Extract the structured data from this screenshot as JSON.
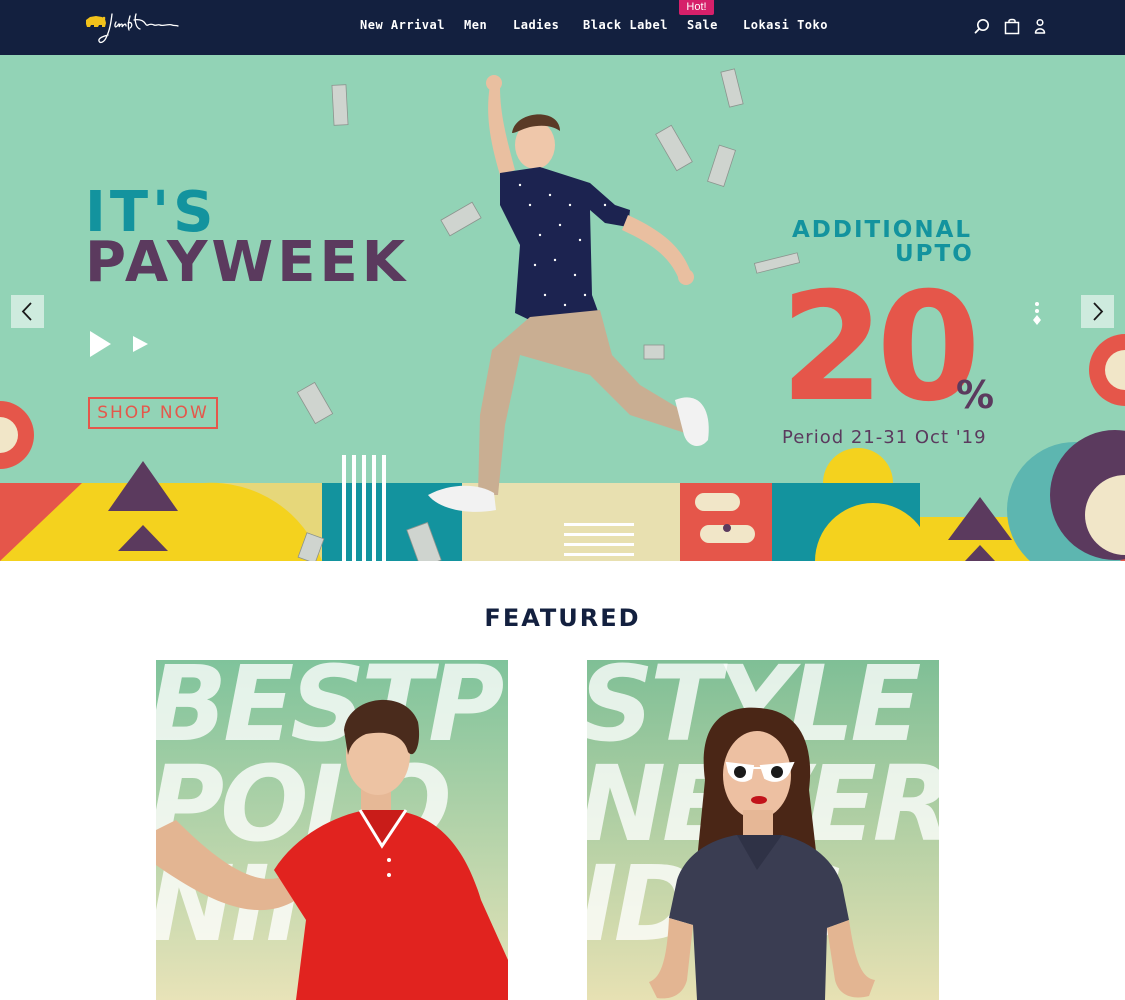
{
  "header": {
    "logo": {
      "icon": "bear-logo-icon",
      "alt": "Jack Nicklaus"
    },
    "nav": [
      {
        "label": "New Arrival"
      },
      {
        "label": "Men"
      },
      {
        "label": "Ladies"
      },
      {
        "label": "Black Label"
      },
      {
        "label": "Sale",
        "badge": "Hot!"
      },
      {
        "label": "Lokasi Toko"
      }
    ],
    "icons": [
      "search-icon",
      "shopping-bag-icon",
      "user-icon"
    ]
  },
  "hero": {
    "headline_line1": "IT'S",
    "headline_line2": "PAYWEEK",
    "cta": "SHOP NOW",
    "promo_line1": "ADDITIONAL",
    "promo_line2": "UPTO",
    "promo_value": "20",
    "promo_unit": "%",
    "promo_period": "Period 21-31 Oct '19",
    "controls": [
      "arrow-left-icon",
      "arrow-right-icon",
      "slide-dots"
    ]
  },
  "featured": {
    "title": "FEATURED",
    "cards": [
      {
        "words": [
          "BESTP",
          "POLO",
          "NIMV"
        ]
      },
      {
        "words": [
          "STYLE",
          "NEVER",
          "IDLG"
        ]
      }
    ]
  },
  "colors": {
    "header_bg": "#13203f",
    "hero_bg": "#92d3b6",
    "teal": "#13939e",
    "plum": "#5b3a5e",
    "coral": "#e5564a",
    "hot_badge": "#d6206a",
    "yellow": "#f4d21e"
  }
}
